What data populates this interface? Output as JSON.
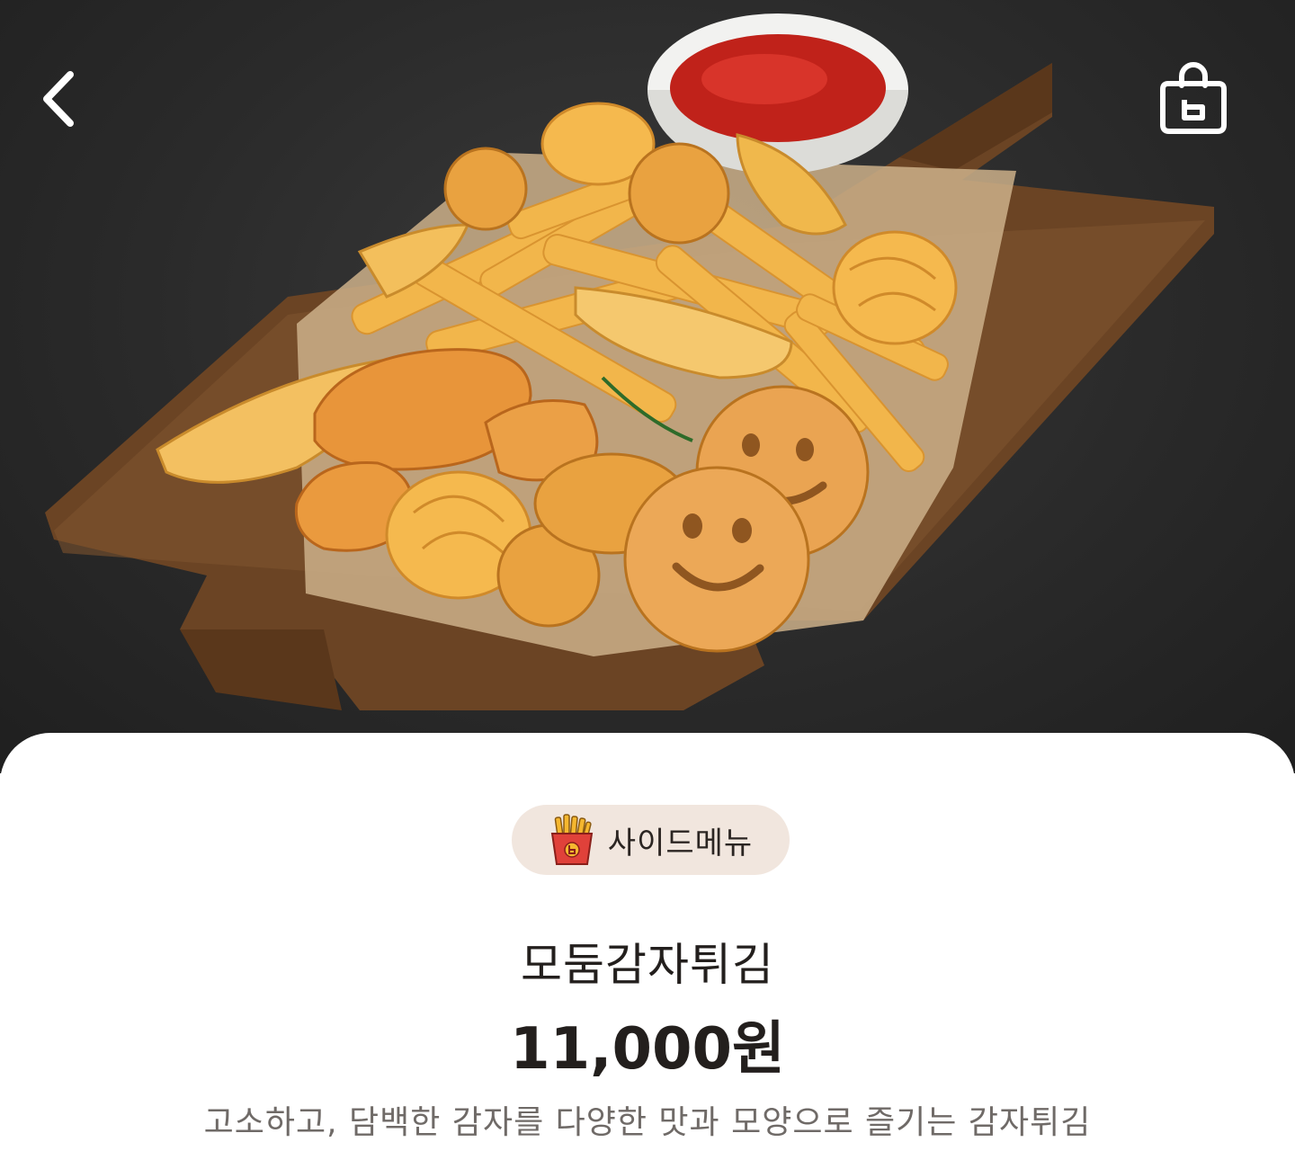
{
  "header": {
    "back_icon": "chevron-left-icon",
    "bag_icon": "shopping-bag-icon",
    "bag_badge": "b"
  },
  "product": {
    "category": "사이드메뉴",
    "category_icon": "french-fries-icon",
    "name": "모둠감자튀김",
    "price": "11,000원",
    "description": "고소하고, 담백한 감자를 다양한 맛과 모양으로 즐기는 감자튀김"
  },
  "colors": {
    "sheet_bg": "#ffffff",
    "chip_bg": "#f1e6de",
    "text_primary": "#231f1d",
    "text_secondary": "#6f6a67",
    "fries_box_red": "#e0413a",
    "fries_yellow": "#f5b72f"
  }
}
